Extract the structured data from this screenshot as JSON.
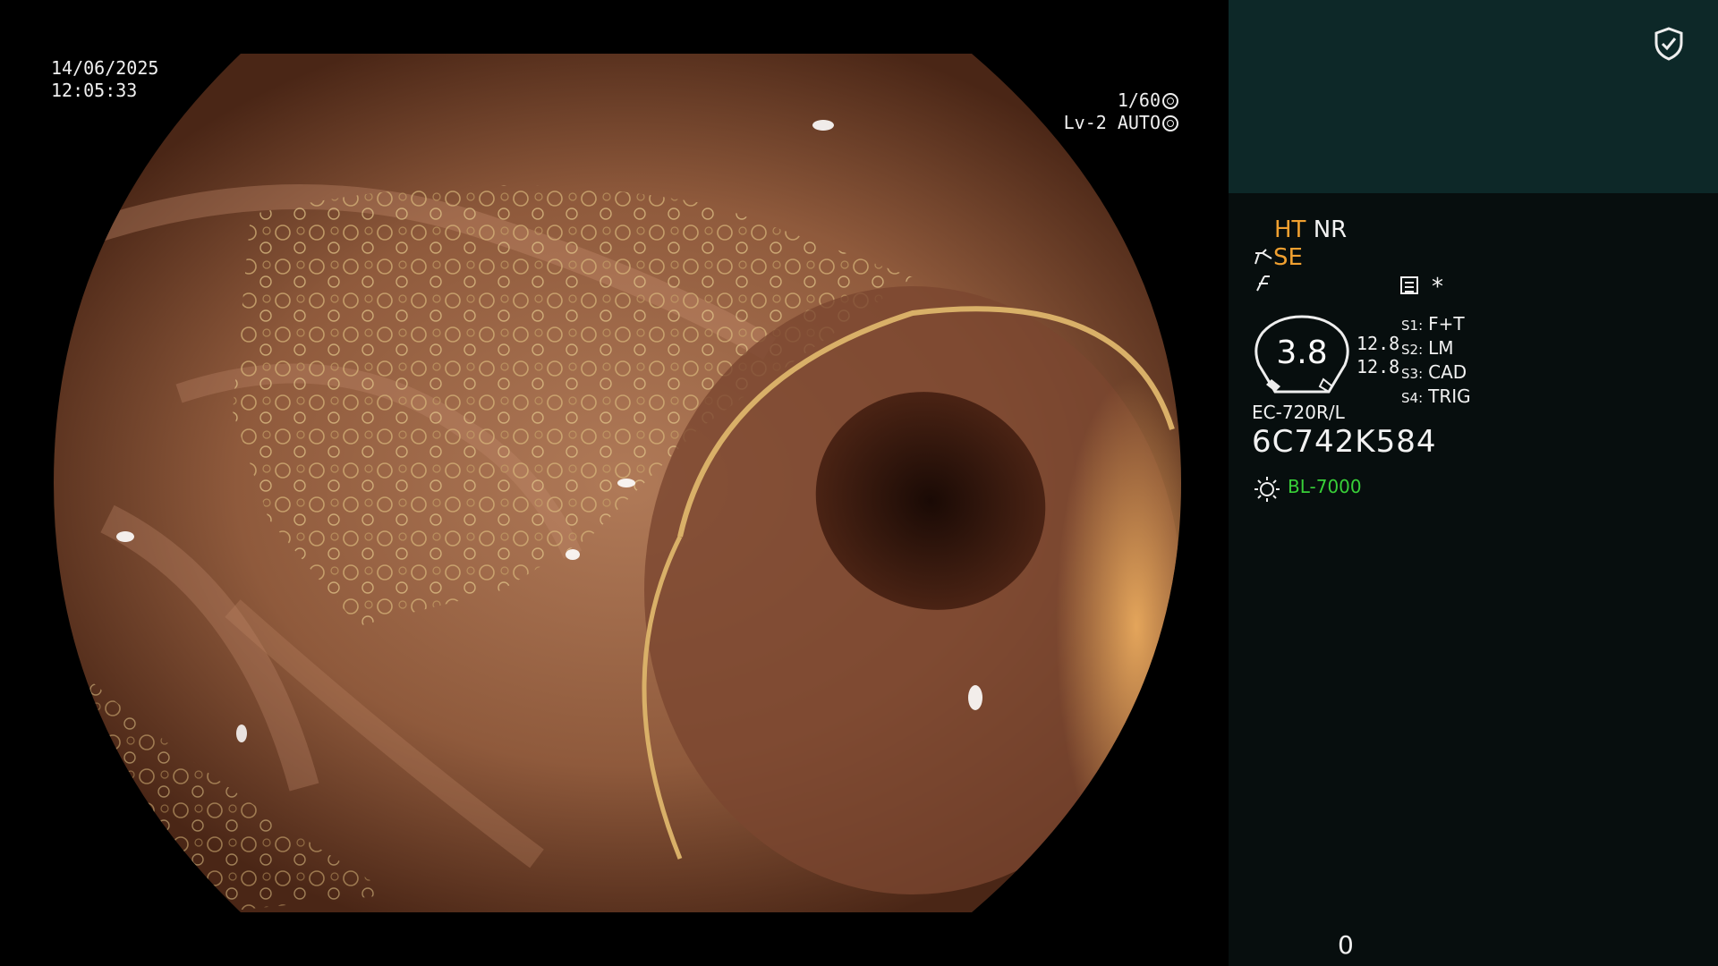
{
  "overlay": {
    "date": "14/06/2025",
    "time": "12:05:33",
    "shutter": "1/60",
    "level": "Lv-2 AUTO"
  },
  "panel": {
    "ht": "HT",
    "nr": "NR",
    "se": "SE",
    "mode_icon_1": "scope-arrow-icon",
    "mode_icon_2": "enhancement-icon",
    "memo_icon": "memo-icon",
    "asterisk": "*",
    "gauge_value": "3.8",
    "value_a": "12.8",
    "value_b": "12.8",
    "switches": [
      {
        "key": "S1:",
        "value": "F+T"
      },
      {
        "key": "S2:",
        "value": "LM"
      },
      {
        "key": "S3:",
        "value": "CAD"
      },
      {
        "key": "S4:",
        "value": "TRIG"
      }
    ],
    "scope_model": "EC-720R/L",
    "scope_serial": "6C742K584",
    "light_source": "BL-7000",
    "counter": "0"
  },
  "colors": {
    "panel_bg": "#070e0e",
    "panel_top": "#0d2828",
    "orange": "#f0a030",
    "green": "#38d038"
  }
}
